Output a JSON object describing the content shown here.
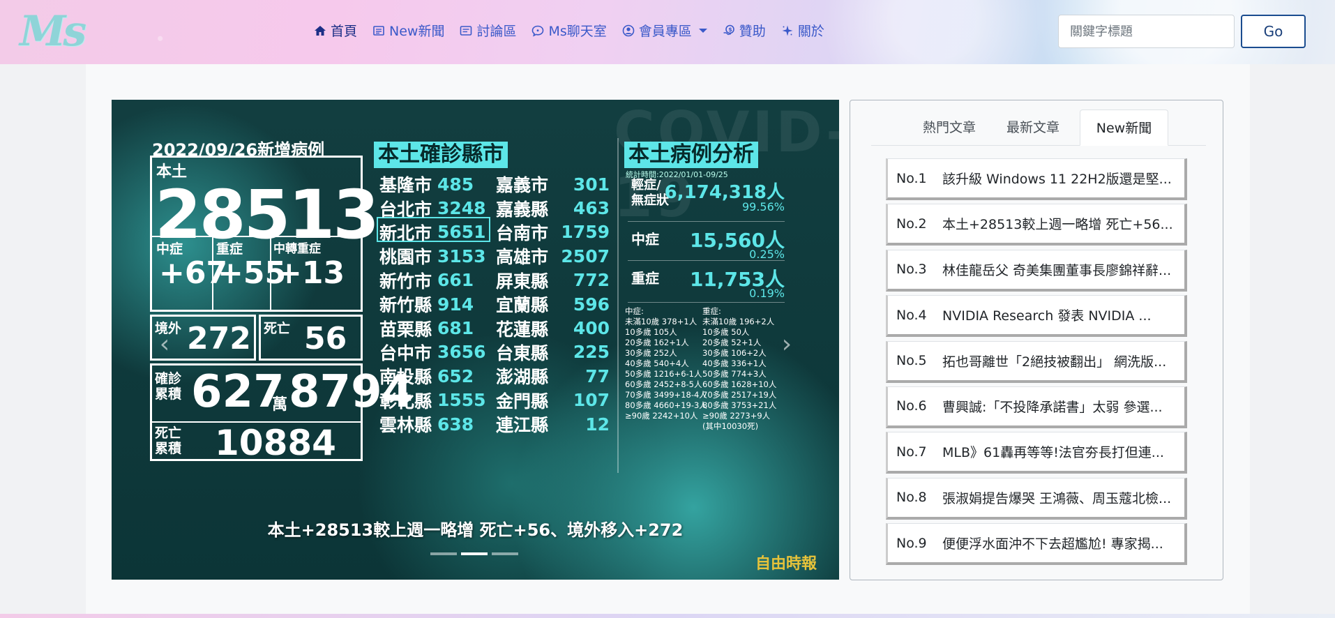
{
  "header": {
    "logo": "Ms",
    "nav": [
      {
        "label": "首頁",
        "icon": "home-icon"
      },
      {
        "label": "New新聞",
        "icon": "newspaper-icon"
      },
      {
        "label": "討論區",
        "icon": "forum-icon"
      },
      {
        "label": "Ms聊天室",
        "icon": "chat-icon"
      },
      {
        "label": "會員專區",
        "icon": "user-icon"
      },
      {
        "label": "贊助",
        "icon": "donate-icon"
      },
      {
        "label": "關於",
        "icon": "sparkle-icon"
      }
    ],
    "search_placeholder": "關鍵字標題",
    "go_label": "Go"
  },
  "carousel": {
    "caption": "本土+28513較上週一略增 死亡+56、境外移入+272",
    "source": "自由時報",
    "bg_text": "COVID-19",
    "infographic": {
      "date": "2022/09/26新增病例",
      "local_label": "本土",
      "local_value": "28513",
      "moderate_label": "中症",
      "moderate_value": "+67",
      "severe_label": "重症",
      "severe_value": "+55",
      "mod_to_severe_label": "中轉重症",
      "mod_to_severe_value": "+13",
      "imported_label": "境外",
      "imported_value": "272",
      "death_label": "死亡",
      "death_value": "56",
      "cum_label": "確診\n累積",
      "cum_value_a": "627",
      "cum_unit": "萬",
      "cum_value_b": "8794",
      "cum_death_label": "死亡\n累積",
      "cum_death_value": "10884",
      "cities_title": "本土確診縣市",
      "cities": [
        [
          "基隆市",
          "485",
          "嘉義市",
          "301"
        ],
        [
          "台北市",
          "3248",
          "嘉義縣",
          "463"
        ],
        [
          "新北市",
          "5651",
          "台南市",
          "1759"
        ],
        [
          "桃園市",
          "3153",
          "高雄市",
          "2507"
        ],
        [
          "新竹市",
          "661",
          "屏東縣",
          "772"
        ],
        [
          "新竹縣",
          "914",
          "宜蘭縣",
          "596"
        ],
        [
          "苗栗縣",
          "681",
          "花蓮縣",
          "400"
        ],
        [
          "台中市",
          "3656",
          "台東縣",
          "225"
        ],
        [
          "南投縣",
          "652",
          "澎湖縣",
          "77"
        ],
        [
          "彰化縣",
          "1555",
          "金門縣",
          "107"
        ],
        [
          "雲林縣",
          "638",
          "連江縣",
          "12"
        ]
      ],
      "analysis_title": "本土病例分析",
      "analysis_period": "統計時間:2022/01/01-09/25",
      "analysis": [
        {
          "label": "輕症/\n無症狀",
          "value": "6,174,318人",
          "pct": "99.56%"
        },
        {
          "label": "中症",
          "value": "15,560人",
          "pct": "0.25%"
        },
        {
          "label": "重症",
          "value": "11,753人",
          "pct": "0.19%"
        }
      ],
      "moderate_breakdown": "中症:\n未滿10歲 378+1人\n10多歲 105人\n20多歲 162+1人\n30多歲 252人\n40多歲 540+4人\n50多歲 1216+6-1人\n60多歲 2452+8-5人\n70多歲 3499+18-4人\n80多歲 4660+19-3人\n≥90歲 2242+10人",
      "severe_breakdown": "重症:\n未滿10歲 196+2人\n10多歲 50人\n20多歲 52+1人\n30多歲 106+2人\n40多歲 336+1人\n50多歲 774+3人\n60多歲 1628+10人\n70多歲 2517+19人\n80多歲 3753+21人\n≥90歲 2273+9人\n(其中10030死)"
    }
  },
  "panel": {
    "tabs": [
      "熱門文章",
      "最新文章",
      "New新聞"
    ],
    "active_tab": "New新聞",
    "news": [
      {
        "no": "No.1",
        "title": "該升級 Windows 11 22H2版還是堅..."
      },
      {
        "no": "No.2",
        "title": "本土+28513較上週一略增 死亡+56..."
      },
      {
        "no": "No.3",
        "title": "林佳龍岳父 奇美集團董事長廖錦祥辭..."
      },
      {
        "no": "No.4",
        "title": "NVIDIA Research 發表 NVIDIA ..."
      },
      {
        "no": "No.5",
        "title": "拓也哥離世「2絕技被翻出」 網洗版..."
      },
      {
        "no": "No.6",
        "title": "曹興誠:「不投降承諾書」太弱 參選..."
      },
      {
        "no": "No.7",
        "title": "MLB》61轟再等等!法官夯長打但連..."
      },
      {
        "no": "No.8",
        "title": "張淑娟提告爆哭 王鴻薇、周玉蔻北檢..."
      },
      {
        "no": "No.9",
        "title": "便便浮水面沖不下去超尷尬! 專家揭..."
      }
    ]
  }
}
